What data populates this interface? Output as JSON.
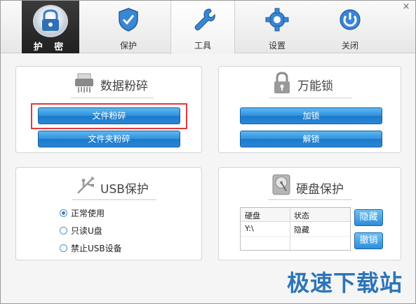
{
  "window": {
    "close_label": "×"
  },
  "header": {
    "logo_label": "护 密"
  },
  "tabs": [
    {
      "label": "保护",
      "icon": "shield-icon"
    },
    {
      "label": "工具",
      "icon": "wrench-icon",
      "active": true
    },
    {
      "label": "设置",
      "icon": "gear-icon"
    },
    {
      "label": "关闭",
      "icon": "power-icon"
    }
  ],
  "shred": {
    "title": "数据粉碎",
    "file_btn": "文件粉碎",
    "folder_btn": "文件夹粉碎"
  },
  "lock": {
    "title": "万能锁",
    "lock_btn": "加锁",
    "unlock_btn": "解锁"
  },
  "usb": {
    "title": "USB保护",
    "options": [
      "正常使用",
      "只读U盘",
      "禁止USB设备"
    ],
    "selected": "正常使用"
  },
  "disk": {
    "title": "硬盘保护",
    "columns": [
      "硬盘",
      "状态"
    ],
    "rows": [
      {
        "disk": "Y:\\",
        "status": "隐藏"
      }
    ],
    "hide_btn": "隐藏",
    "undo_btn": "撤销"
  },
  "watermark": "极速下载站",
  "colors": {
    "accent": "#2f90dc",
    "highlight": "#e03a3a",
    "watermark": "#2c75b8"
  }
}
